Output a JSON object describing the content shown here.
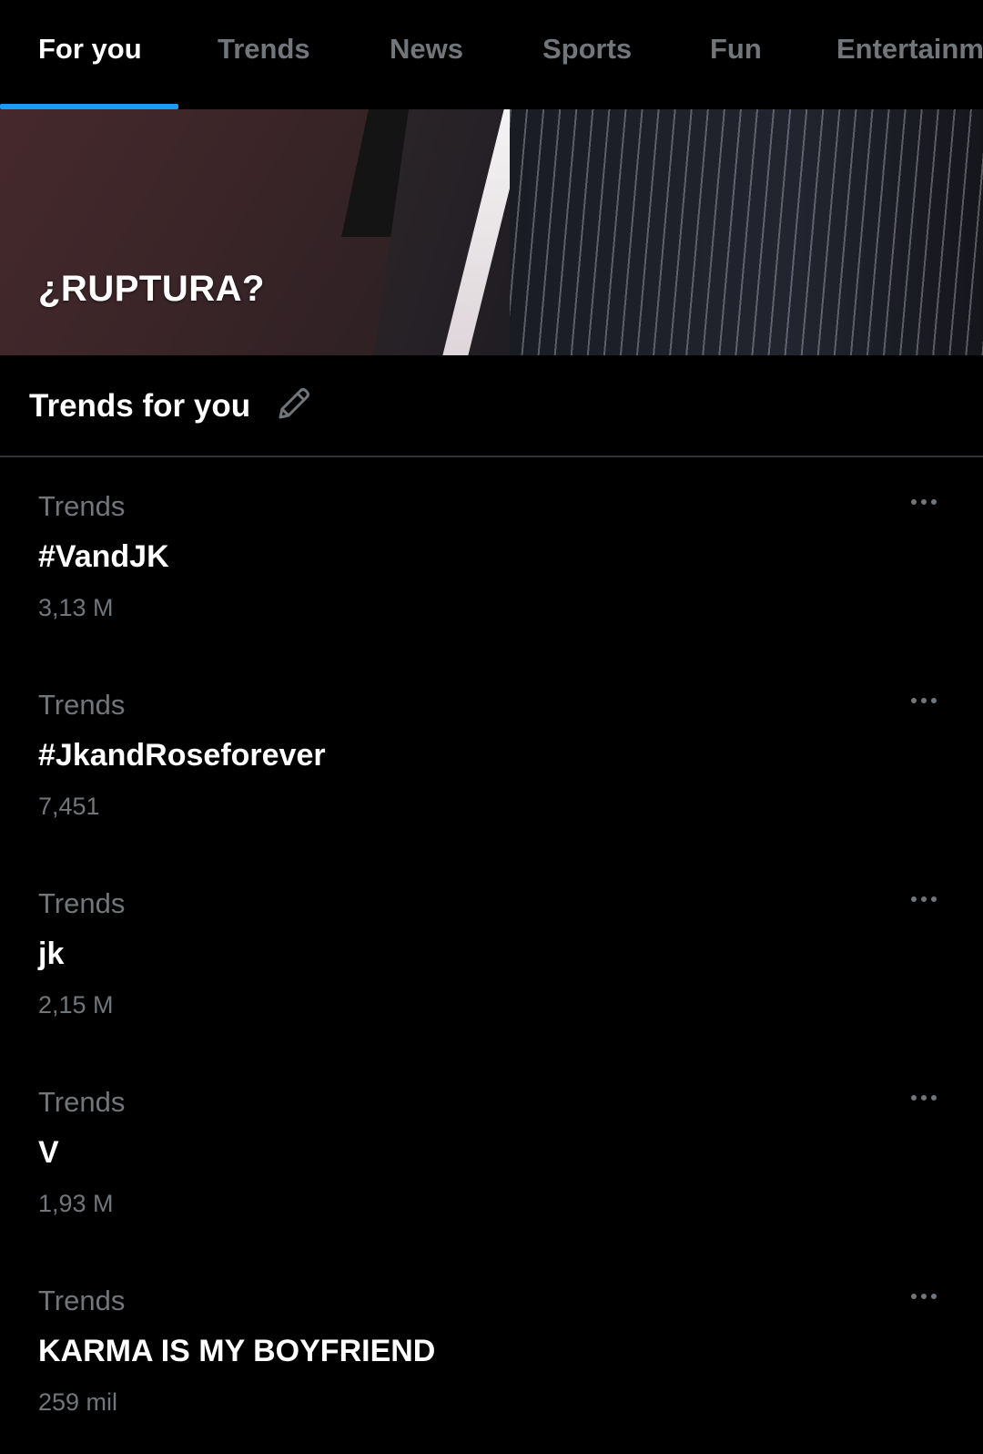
{
  "tabs": [
    {
      "label": "For you",
      "active": true
    },
    {
      "label": "Trends",
      "active": false
    },
    {
      "label": "News",
      "active": false
    },
    {
      "label": "Sports",
      "active": false
    },
    {
      "label": "Fun",
      "active": false
    },
    {
      "label": "Entertainm",
      "active": false
    }
  ],
  "hero": {
    "title": "¿RUPTURA?"
  },
  "section": {
    "title": "Trends for you",
    "edit_icon": "pencil-icon"
  },
  "trends": [
    {
      "category": "Trends",
      "name": "#VandJK",
      "count": "3,13 M"
    },
    {
      "category": "Trends",
      "name": "#JkandRoseforever",
      "count": "7,451"
    },
    {
      "category": "Trends",
      "name": "jk",
      "count": "2,15 M"
    },
    {
      "category": "Trends",
      "name": "V",
      "count": "1,93 M"
    },
    {
      "category": "Trends",
      "name": "KARMA IS MY BOYFRIEND",
      "count": "259 mil"
    }
  ],
  "colors": {
    "background": "#000000",
    "accent": "#1d9bf0",
    "secondary_text": "#71767b",
    "divider": "#2f3336"
  }
}
